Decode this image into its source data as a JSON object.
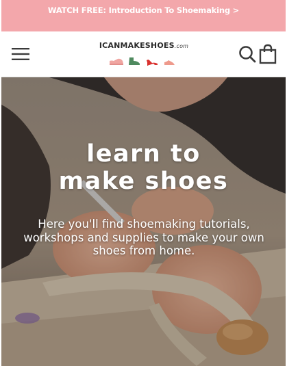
{
  "announcement": {
    "text": "WATCH FREE: Introduction To Shoemaking >"
  },
  "header": {
    "logo_text": "ICANMAKESHOES",
    "logo_domain": ".com",
    "menu_icon": "hamburger-menu-icon",
    "search_icon": "search-icon",
    "cart_icon": "shopping-bag-icon"
  },
  "hero": {
    "title_line1": "learn to",
    "title_line2": "make shoes",
    "subtitle": "Here you'll find shoemaking tutorials, workshops and supplies to make your own shoes from home."
  },
  "colors": {
    "announcement_bg": "#f3a7ab",
    "announcement_text": "#ffffff",
    "icon_color": "#3a3a3a",
    "shoe_pink": "#f0a6a2",
    "shoe_green": "#4f8a5f",
    "shoe_red": "#d9322f",
    "shoe_coral": "#ee9a8c"
  }
}
